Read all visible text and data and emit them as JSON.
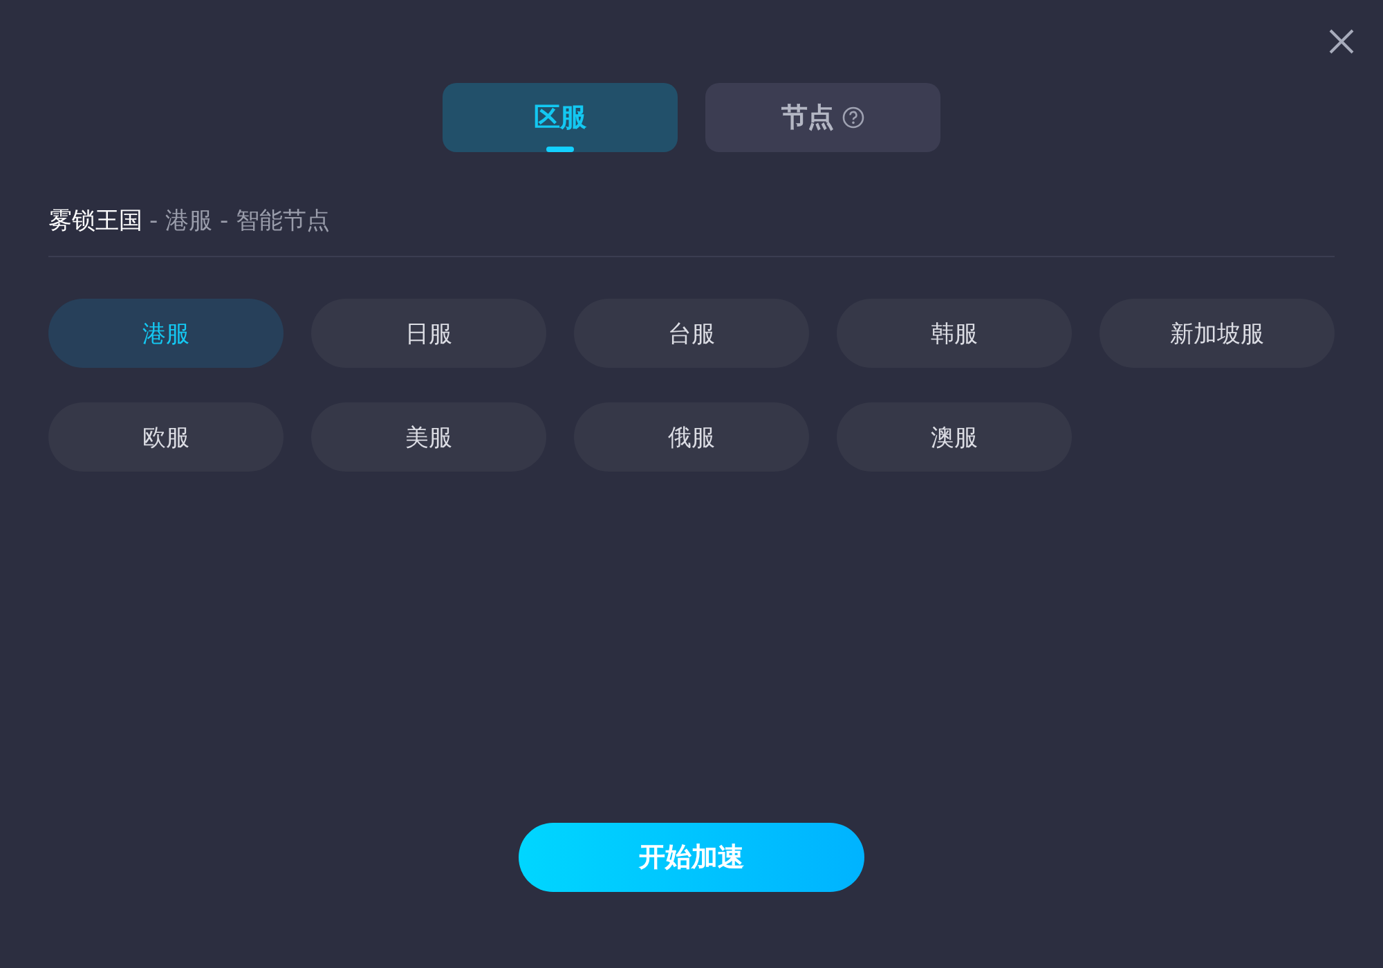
{
  "tabs": [
    {
      "label": "区服",
      "selected": true,
      "help": false
    },
    {
      "label": "节点",
      "selected": false,
      "help": true
    }
  ],
  "breadcrumb": {
    "game": "雾锁王国",
    "path": "- 港服 - 智能节点"
  },
  "servers": [
    {
      "label": "港服",
      "selected": true
    },
    {
      "label": "日服",
      "selected": false
    },
    {
      "label": "台服",
      "selected": false
    },
    {
      "label": "韩服",
      "selected": false
    },
    {
      "label": "新加坡服",
      "selected": false
    },
    {
      "label": "欧服",
      "selected": false
    },
    {
      "label": "美服",
      "selected": false
    },
    {
      "label": "俄服",
      "selected": false
    },
    {
      "label": "澳服",
      "selected": false
    }
  ],
  "start_button": "开始加速"
}
